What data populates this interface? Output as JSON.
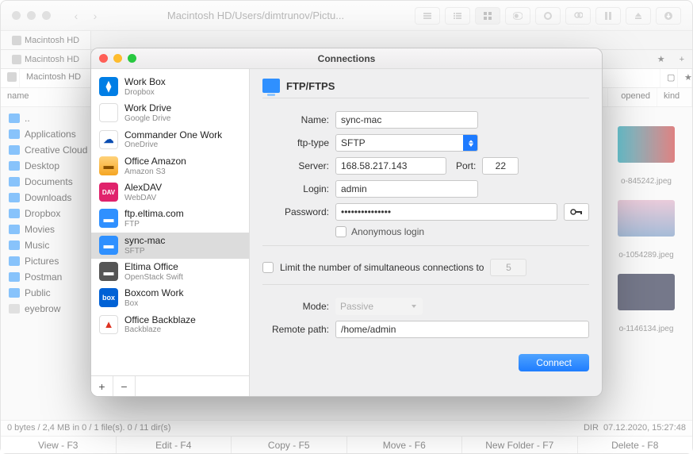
{
  "bg": {
    "title": "Macintosh HD/Users/dimtrunov/Pictu...",
    "tab1": "Macintosh HD",
    "tab2": "Macintosh HD",
    "crumb": "Macintosh HD",
    "col_name": "name",
    "col_opened": "opened",
    "col_kind": "kind",
    "sidebar": [
      "..",
      "Applications",
      "Creative Cloud",
      "Desktop",
      "Documents",
      "Downloads",
      "Dropbox",
      "Movies",
      "Music",
      "Pictures",
      "Postman",
      "Public",
      "eyebrow"
    ],
    "files": [
      "o-845242.jpeg",
      "o-1054289.jpeg",
      "o-1146134.jpeg"
    ],
    "status_left": "0 bytes / 2,4 MB in 0 / 1 file(s). 0 / 11 dir(s)",
    "status_right_dir": "DIR",
    "status_right_date": "07.12.2020, 15:27:48",
    "fn": [
      "View - F3",
      "Edit - F4",
      "Copy - F5",
      "Move - F6",
      "New Folder - F7",
      "Delete - F8"
    ]
  },
  "modal": {
    "title": "Connections",
    "list": [
      {
        "name": "Work Box",
        "sub": "Dropbox"
      },
      {
        "name": "Work Drive",
        "sub": "Google Drive"
      },
      {
        "name": "Commander One Work",
        "sub": "OneDrive"
      },
      {
        "name": "Office Amazon",
        "sub": "Amazon S3"
      },
      {
        "name": "AlexDAV",
        "sub": "WebDAV"
      },
      {
        "name": "ftp.eltima.com",
        "sub": "FTP"
      },
      {
        "name": "sync-mac",
        "sub": "SFTP"
      },
      {
        "name": "Eltima Office",
        "sub": "OpenStack Swift"
      },
      {
        "name": "Boxcom Work",
        "sub": "Box"
      },
      {
        "name": "Office Backblaze",
        "sub": "Backblaze"
      }
    ],
    "glyphs": {
      "plus": "+",
      "minus": "−"
    },
    "header": "FTP/FTPS",
    "labels": {
      "name": "Name:",
      "ftp_type": "ftp-type",
      "server": "Server:",
      "port": "Port:",
      "login": "Login:",
      "password": "Password:",
      "anon": "Anonymous login",
      "limit": "Limit the number of simultaneous connections to",
      "mode": "Mode:",
      "remote": "Remote path:"
    },
    "values": {
      "name": "sync-mac",
      "ftp_type": "SFTP",
      "server": "168.58.217.143",
      "port": "22",
      "login": "admin",
      "password": "•••••••••••••••",
      "limit": "5",
      "mode": "Passive",
      "remote": "/home/admin"
    },
    "connect": "Connect"
  }
}
